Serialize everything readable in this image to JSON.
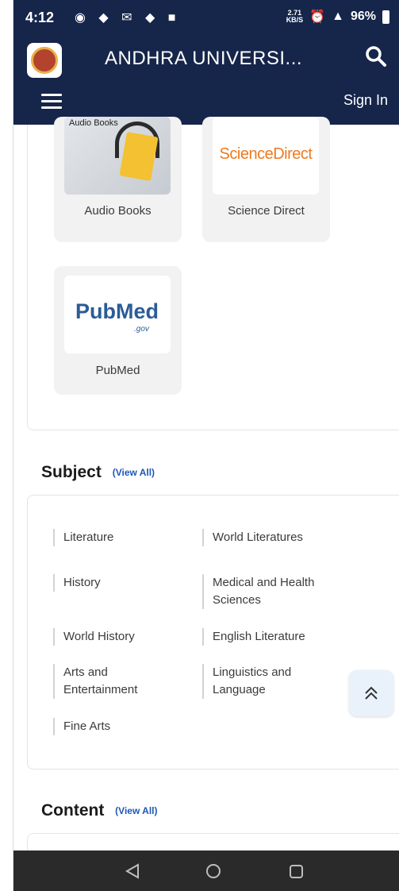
{
  "status_bar": {
    "time": "4:12",
    "speed_value": "2.71",
    "speed_unit": "KB/S",
    "battery": "96%"
  },
  "header": {
    "title": "ANDHRA UNIVERSI...",
    "sign_in": "Sign In",
    "colors": {
      "background": "#16254a"
    }
  },
  "resources": [
    {
      "label": "Audio Books",
      "image_text": "Audio Books"
    },
    {
      "label": "Science Direct",
      "image_text": "ScienceDirect"
    },
    {
      "label": "PubMed",
      "image_text": "PubMed",
      "image_subtext": ".gov"
    }
  ],
  "subject": {
    "title": "Subject",
    "view_all": "(View All)",
    "items": [
      "Literature",
      "World Literatures",
      "History",
      "Medical and Health Sciences",
      "World History",
      "English Literature",
      "Arts and Entertainment",
      "Linguistics and Language",
      "Fine Arts"
    ]
  },
  "content": {
    "title": "Content",
    "view_all": "(View All)"
  },
  "icons": {
    "search": "search-icon",
    "menu": "hamburger-menu-icon",
    "scroll_top": "double-chevron-up-icon",
    "nav_back": "back-triangle-icon",
    "nav_home": "home-circle-icon",
    "nav_recents": "recents-square-icon"
  }
}
